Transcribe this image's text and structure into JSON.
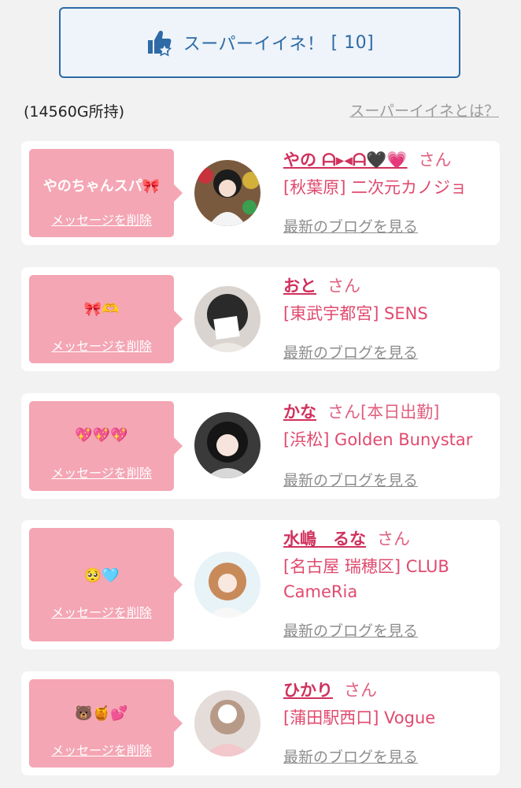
{
  "header": {
    "button_label": "スーパーイイネ！",
    "count": "[ 10]",
    "owned": "(14560G所持)",
    "what_is_link": "スーパーイイネとは？"
  },
  "common": {
    "delete_label": "メッセージを削除",
    "blog_label": "最新のブログを見る",
    "san": "さん"
  },
  "entries": [
    {
      "message": "やのちゃんスパ🎀",
      "name": "やの ᗩ▸◂ᗩ🖤💗",
      "status": "",
      "shop": "[秋葉原] 二次元カノジョ"
    },
    {
      "message": "🎀🫶",
      "name": "おと",
      "status": "",
      "shop": "[東武宇都宮] SENS"
    },
    {
      "message": "💖💖💖",
      "name": "かな",
      "status": "[本日出勤]",
      "shop": "[浜松] Golden Bunystar"
    },
    {
      "message": "🥺🩵",
      "name": "水嶋　るな",
      "status": "",
      "shop": "[名古屋 瑞穂区] CLUB CameRia"
    },
    {
      "message": "🐻🍯💕",
      "name": "ひかり",
      "status": "",
      "shop": "[蒲田駅西口] Vogue"
    }
  ],
  "colors": {
    "accent_blue": "#2d6aa6",
    "bubble_pink": "#f4a6b4",
    "name_pink": "#d0315c"
  }
}
